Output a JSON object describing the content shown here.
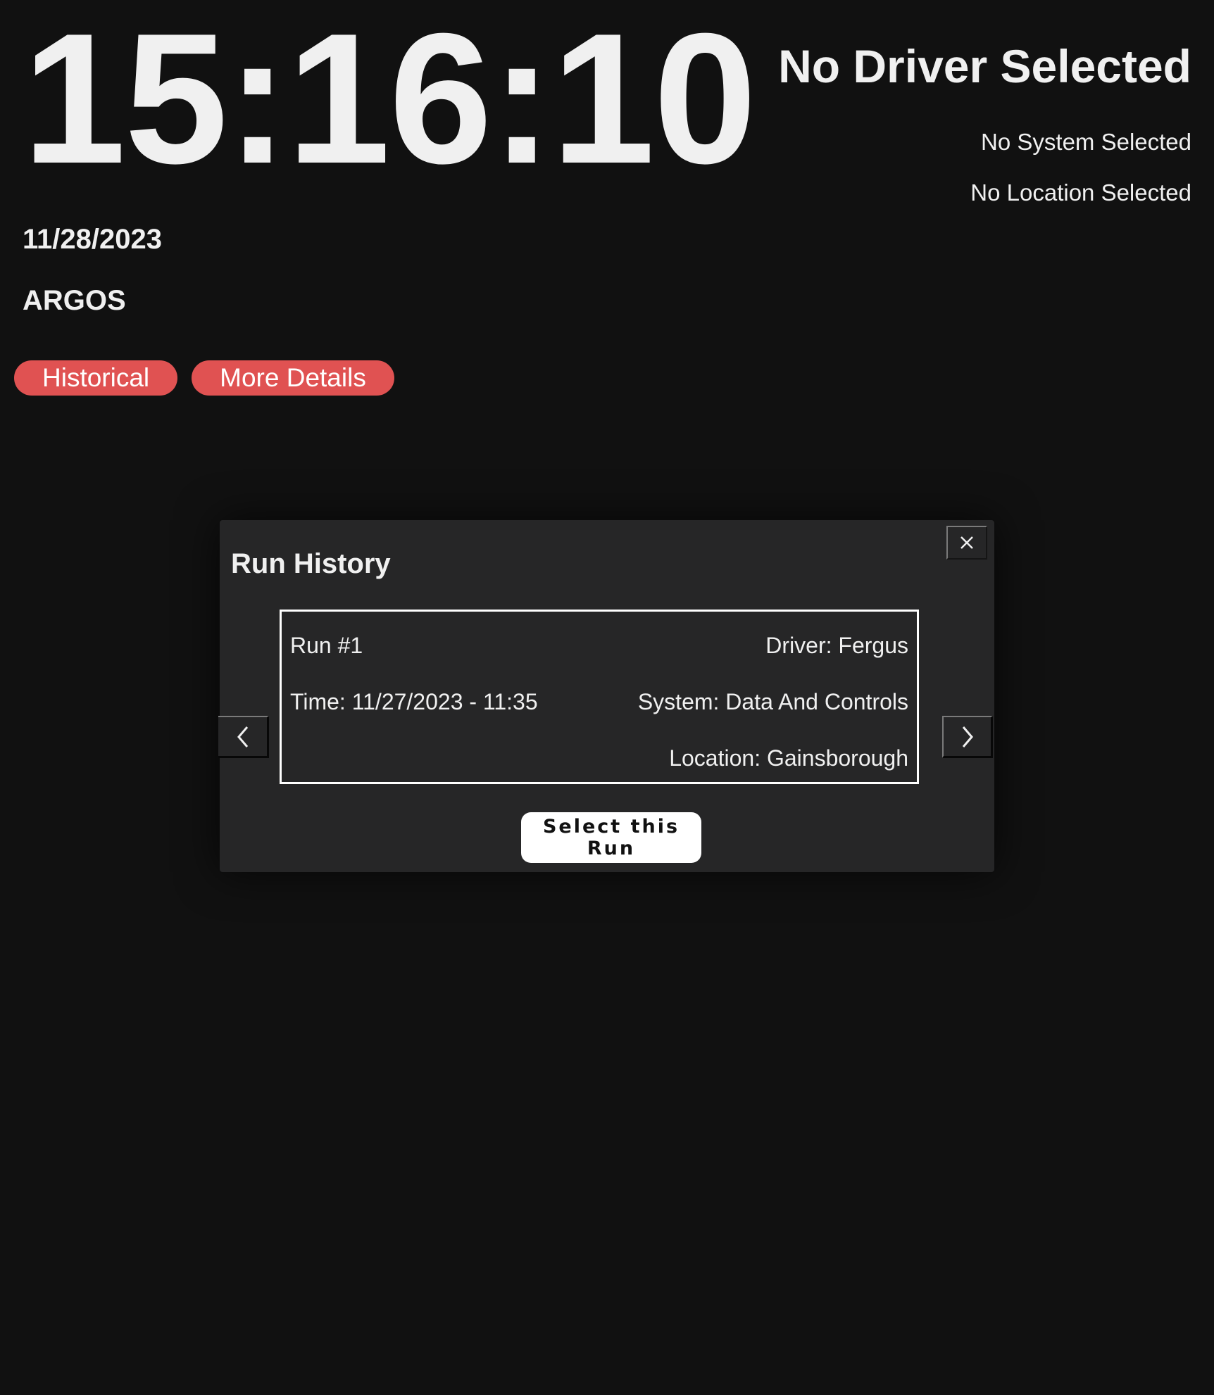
{
  "header": {
    "clock": "15:16:10",
    "date": "11/28/2023",
    "app_name": "ARGOS",
    "driver_status": "No Driver Selected",
    "system_status": "No System Selected",
    "location_status": "No Location Selected"
  },
  "actions": {
    "historical_label": "Historical",
    "more_details_label": "More Details",
    "accent_color": "#e05252"
  },
  "modal": {
    "title": "Run History",
    "close_icon": "close-icon",
    "prev_icon": "chevron-left-icon",
    "next_icon": "chevron-right-icon",
    "run": {
      "number": "Run #1",
      "time": "Time: 11/27/2023 - 11:35",
      "driver": "Driver: Fergus",
      "system": "System: Data And Controls",
      "location": "Location: Gainsborough"
    },
    "select_label": "Select this Run"
  }
}
